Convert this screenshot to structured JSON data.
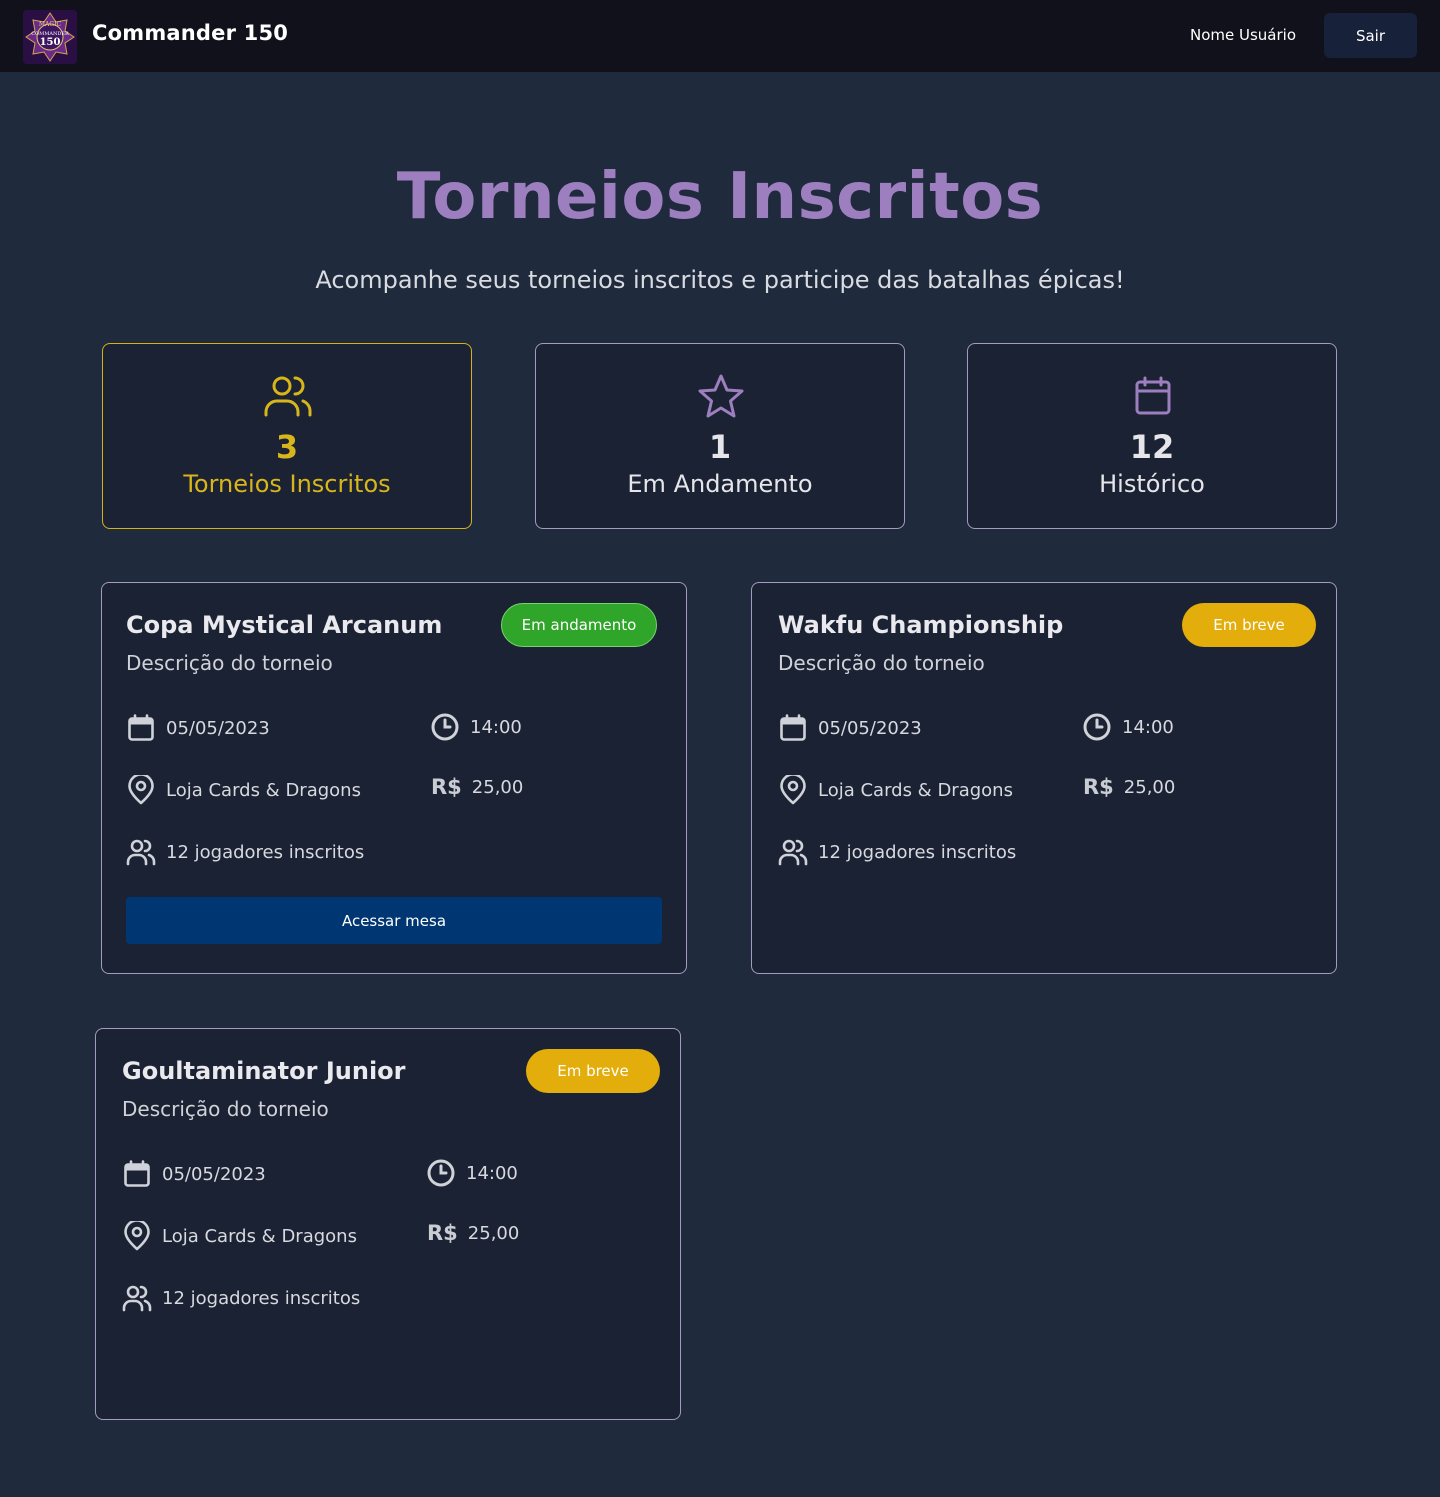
{
  "header": {
    "app_title": "Commander 150",
    "user_name": "Nome Usuário",
    "logout_label": "Sair",
    "logo_text_top": "MAGIC",
    "logo_text_mid": "COMMANDER",
    "logo_text_num": "150"
  },
  "hero": {
    "title": "Torneios Inscritos",
    "subtitle": "Acompanhe seus torneios inscritos e participe das batalhas épicas!"
  },
  "stats": [
    {
      "icon": "users-icon",
      "value": "3",
      "label": "Torneios Inscritos",
      "active": true
    },
    {
      "icon": "star-icon",
      "value": "1",
      "label": "Em Andamento",
      "active": false
    },
    {
      "icon": "calendar-icon",
      "value": "12",
      "label": "Histórico",
      "active": false
    }
  ],
  "tournaments": [
    {
      "name": "Copa Mystical Arcanum",
      "description": "Descrição do torneio",
      "status": "Em andamento",
      "date": "05/05/2023",
      "time": "14:00",
      "location": "Loja Cards & Dragons",
      "currency": "R$",
      "price": "25,00",
      "players": "12 jogadores inscritos",
      "action_label": "Acessar mesa"
    },
    {
      "name": "Wakfu Championship",
      "description": "Descrição do torneio",
      "status": "Em breve",
      "date": "05/05/2023",
      "time": "14:00",
      "location": "Loja Cards & Dragons",
      "currency": "R$",
      "price": "25,00",
      "players": "12 jogadores inscritos"
    },
    {
      "name": "Goultaminator Junior",
      "description": "Descrição do torneio",
      "status": "Em breve",
      "date": "05/05/2023",
      "time": "14:00",
      "location": "Loja Cards & Dragons",
      "currency": "R$",
      "price": "25,00",
      "players": "12 jogadores inscritos"
    }
  ],
  "colors": {
    "page_bg": "#1f2a3d",
    "topbar_bg": "#11111c",
    "card_bg": "#1b2233",
    "card_border": "#a59ac0",
    "title_purple": "#9d7fbf",
    "accent_yellow": "#d8b61b",
    "live_green": "#2fa52a",
    "soon_amber": "#e3ad0b",
    "action_blue": "#003772"
  }
}
